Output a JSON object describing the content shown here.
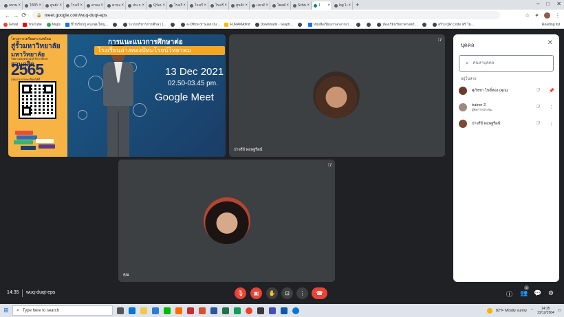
{
  "browser": {
    "tabs": [
      "อบรมการ",
      "ให้มีวิทยา",
      "ศูนย์เรียน",
      "โรงเรียน",
      "ตามแนว",
      "ตามแนว",
      "ประกาศ",
      "Qร์แน",
      "โรงเรียน",
      "โรงเรียน",
      "โรงเรียน",
      "ศูนย์เรียน",
      "แนวคิด",
      "โพสต์",
      "School",
      "1",
      "log ไอ"
    ],
    "active_tab_index": 15,
    "url": "meet.google.com/wuq-duqt-eps",
    "reading_list": "Reading list",
    "bookmarks": [
      "Gmail",
      "YouTube",
      "Maps",
      "ปีไปเรียนรู้ คนกลุ่มใหญ่...",
      "",
      "ระบบบริหารการศึกษา (...",
      "",
      "e-Office of Suan Du...",
      "FURAMAfind",
      "Downloads - Graph...",
      "",
      "หนังสือเรียนภาษาจากเว...",
      "",
      "",
      "ห้องเรียนวิทยาศาสตร์...",
      "",
      "สร้าง QR Code ฟรี ไม่..."
    ]
  },
  "presentation": {
    "line1": "โครงการเตรียมความพร้อม",
    "line2": "สู่รั้วมหาวิทยาลัย",
    "line3": "มหาวิทยาลัยสวนดุสิต",
    "subtitle": "วิทยาเขตสุพรรณบุรี ปีการศึกษา",
    "year": "2565",
    "small": "สอบถามรายละเอียดได้ที่",
    "head1": "การแนะแนวการศึกษาต่อ",
    "head2": "โรงเรียนอ่างทองปัทมโรจน์วิทยาคม",
    "date": "13 Dec 2021",
    "time": "02.50-03.45 pm.",
    "platform": "Google Meet"
  },
  "participants_tiles": [
    {
      "name": "ปาจรีย์ พฤษฐรีดน์"
    },
    {
      "name": "คุณ"
    }
  ],
  "people_panel": {
    "title": "บุคคล",
    "search_placeholder": "ค้นหาบุคคล",
    "section": "อยู่ในสาย",
    "people": [
      {
        "name": "ศุภัชชา ไพยี่ทอง (คุณ)",
        "sub": ""
      },
      {
        "name": "trainer 2",
        "sub": "ผู้จัดการประชุม"
      },
      {
        "name": "ปาจรีย์ พฤษฐรีดน์",
        "sub": ""
      }
    ]
  },
  "bottom_bar": {
    "time": "14:35",
    "meeting_code": "wuq-duqt-eps",
    "people_count": "3"
  },
  "taskbar": {
    "search_placeholder": "Type here to search",
    "weather": "82°F  Mostly sunny",
    "clock_time": "14:35",
    "clock_date": "13/12/2564"
  }
}
